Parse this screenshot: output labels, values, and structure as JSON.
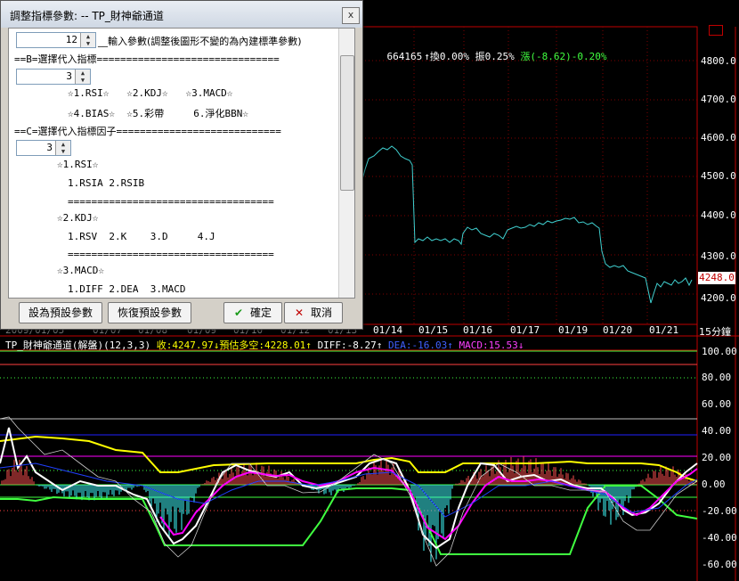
{
  "dialog": {
    "title": "調整指標參數: -- TP_財神爺通道",
    "close": "x",
    "param1_value": "12",
    "param1_desc": "__輸入參數(調整後圖形不變的為內建標準參數)",
    "section_b": "==B=選擇代入指標===============================",
    "param2_value": "3",
    "b_options_1": "☆1.RSI☆   ☆2.KDJ☆   ☆3.MACD☆",
    "b_options_2": "☆4.BIAS☆  ☆5.彩帶     6.淨化BBN☆",
    "section_c": "==C=選擇代入指標因子============================",
    "param3_value": "3",
    "c_rsi": "☆1.RSI☆",
    "c_rsi_items": "1.RSIA 2.RSIB",
    "c_divider": "===================================",
    "c_kdj": "☆2.KDJ☆",
    "c_kdj_items": "1.RSV  2.K    3.D     4.J",
    "c_macd": "☆3.MACD☆",
    "c_macd_items": "1.DIFF 2.DEA  3.MACD",
    "btn_set_default": "設為預設參數",
    "btn_restore_default": "恢復預設參數",
    "btn_ok": "確定",
    "btn_cancel": "取消"
  },
  "top_info": {
    "volume_text": "664165",
    "turnover": "↑換0.00%",
    "amplitude": "振0.25%",
    "change": "漲(-8.62)-0.20%"
  },
  "price_axis": {
    "ticks": [
      "4800.0",
      "4700.0",
      "4600.0",
      "4500.0",
      "4400.0",
      "4300.0",
      "4200.0"
    ],
    "current_price": "4248.0"
  },
  "date_axis": {
    "labels": [
      "2009/01/05",
      "01/07",
      "01/08",
      "01/09",
      "01/10",
      "01/12",
      "01/13",
      "01/14",
      "01/15",
      "01/16",
      "01/17",
      "01/19",
      "01/20",
      "01/21"
    ],
    "period": "15分鐘"
  },
  "indicator_header": {
    "name": "TP_財神爺通道(解盤)(12,3,3)",
    "close": "收:4247.97↓",
    "forecast": "預估多空:4228.01↑",
    "diff": "DIFF:-8.27↑",
    "dea": "DEA:-16.03↑",
    "macd": "MACD:15.53↓"
  },
  "indicator_axis": {
    "ticks": [
      "100.00",
      "80.00",
      "60.00",
      "40.00",
      "20.00",
      "0.00",
      "-20.00",
      "-40.00",
      "-60.00"
    ]
  },
  "colors": {
    "price_line": "#40d0d0",
    "grid_red": "#c00000",
    "yellow": "#ffff00",
    "white": "#ffffff",
    "magenta": "#ff00ff",
    "green": "#40ff40",
    "blue": "#2020ff",
    "hist_pos": "#ff5050",
    "hist_neg": "#40ffff"
  }
}
